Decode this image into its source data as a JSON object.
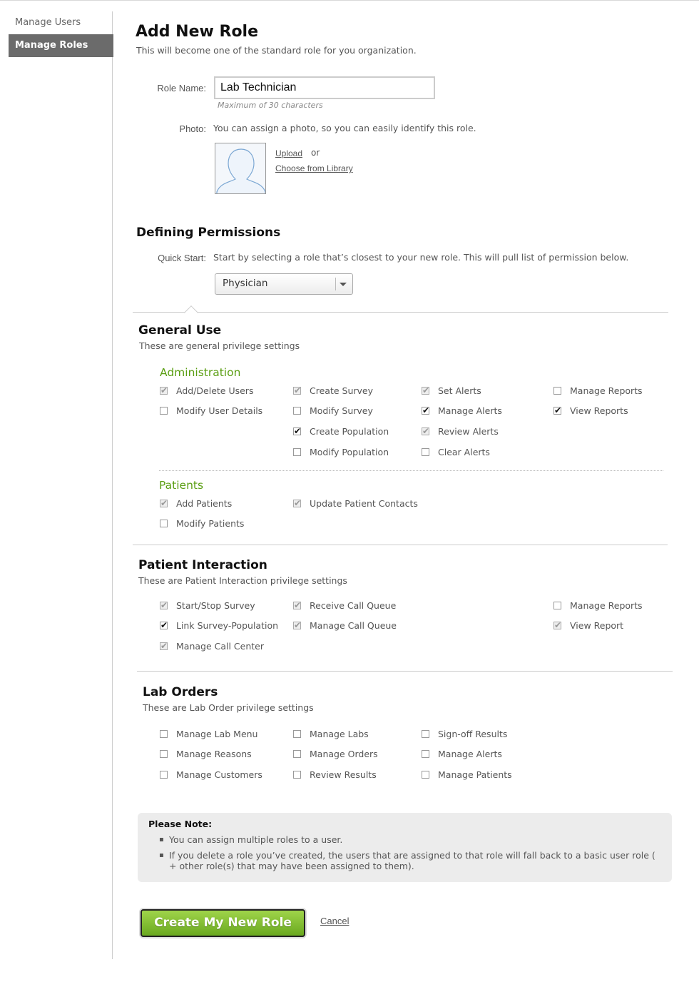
{
  "sidebar": {
    "items": [
      {
        "label": "Manage Users"
      },
      {
        "label": "Manage Roles"
      }
    ]
  },
  "header": {
    "title": "Add New Role",
    "subtitle": "This will become one of the standard role for you organization."
  },
  "role_form": {
    "role_name_label": "Role Name:",
    "role_name_value": "Lab Technician",
    "role_name_hint": "Maximum of 30 characters",
    "photo_label": "Photo:",
    "photo_description": "You can assign a photo, so you can easily identify this role.",
    "upload_link": "Upload",
    "or_text": "or",
    "library_link": "Choose from Library"
  },
  "permissions": {
    "title": "Defining Permissions",
    "quick_start_label": "Quick Start:",
    "quick_start_description": "Start by selecting a role that’s closest to your new role.  This will pull list of permission below.",
    "selected_role": "Physician"
  },
  "general_use": {
    "title": "General Use",
    "subtitle": "These are general privilege settings",
    "administration_title": "Administration",
    "administration": [
      {
        "label": "Add/Delete Users",
        "state": "disabled"
      },
      {
        "label": "Modify User Details",
        "state": "unchecked"
      },
      {
        "label": "Create Survey",
        "state": "disabled"
      },
      {
        "label": "Modify Survey",
        "state": "unchecked"
      },
      {
        "label": "Create Population",
        "state": "checked"
      },
      {
        "label": "Modify Population",
        "state": "unchecked"
      },
      {
        "label": "Set Alerts",
        "state": "disabled"
      },
      {
        "label": "Manage Alerts",
        "state": "checked"
      },
      {
        "label": "Review Alerts",
        "state": "disabled"
      },
      {
        "label": "Clear Alerts",
        "state": "unchecked"
      },
      {
        "label": "Manage Reports",
        "state": "unchecked"
      },
      {
        "label": "View Reports",
        "state": "checked"
      }
    ],
    "patients_title": "Patients",
    "patients": [
      {
        "label": "Add Patients",
        "state": "disabled"
      },
      {
        "label": "Modify Patients",
        "state": "unchecked"
      },
      {
        "label": "Update Patient Contacts",
        "state": "disabled"
      }
    ]
  },
  "patient_interaction": {
    "title": "Patient Interaction",
    "subtitle": "These are Patient Interaction privilege settings",
    "items": [
      {
        "label": "Start/Stop Survey",
        "state": "disabled"
      },
      {
        "label": "Link Survey-Population",
        "state": "checked"
      },
      {
        "label": "Manage Call Center",
        "state": "disabled"
      },
      {
        "label": "Receive Call Queue",
        "state": "disabled"
      },
      {
        "label": "Manage Call Queue",
        "state": "disabled"
      },
      {
        "label": "Manage Reports",
        "state": "unchecked"
      },
      {
        "label": "View Report",
        "state": "disabled"
      }
    ]
  },
  "lab_orders": {
    "title": "Lab Orders",
    "subtitle": "These are Lab Order privilege settings",
    "items": [
      {
        "label": "Manage Lab Menu",
        "state": "unchecked"
      },
      {
        "label": "Manage Reasons",
        "state": "unchecked"
      },
      {
        "label": "Manage Customers",
        "state": "unchecked"
      },
      {
        "label": "Manage Labs",
        "state": "unchecked"
      },
      {
        "label": "Manage Orders",
        "state": "unchecked"
      },
      {
        "label": "Review Results",
        "state": "unchecked"
      },
      {
        "label": "Sign-off Results",
        "state": "unchecked"
      },
      {
        "label": "Manage Alerts",
        "state": "unchecked"
      },
      {
        "label": "Manage Patients",
        "state": "unchecked"
      }
    ]
  },
  "note": {
    "title": "Please Note:",
    "bullet": "▪",
    "items": [
      "You can assign multiple roles to a user.",
      "If you delete a role you’ve created, the users that are assigned to that role will fall back to a basic user role ( + other role(s) that may have been assigned to them)."
    ]
  },
  "actions": {
    "create_label": "Create My New Role",
    "cancel_label": "Cancel"
  }
}
